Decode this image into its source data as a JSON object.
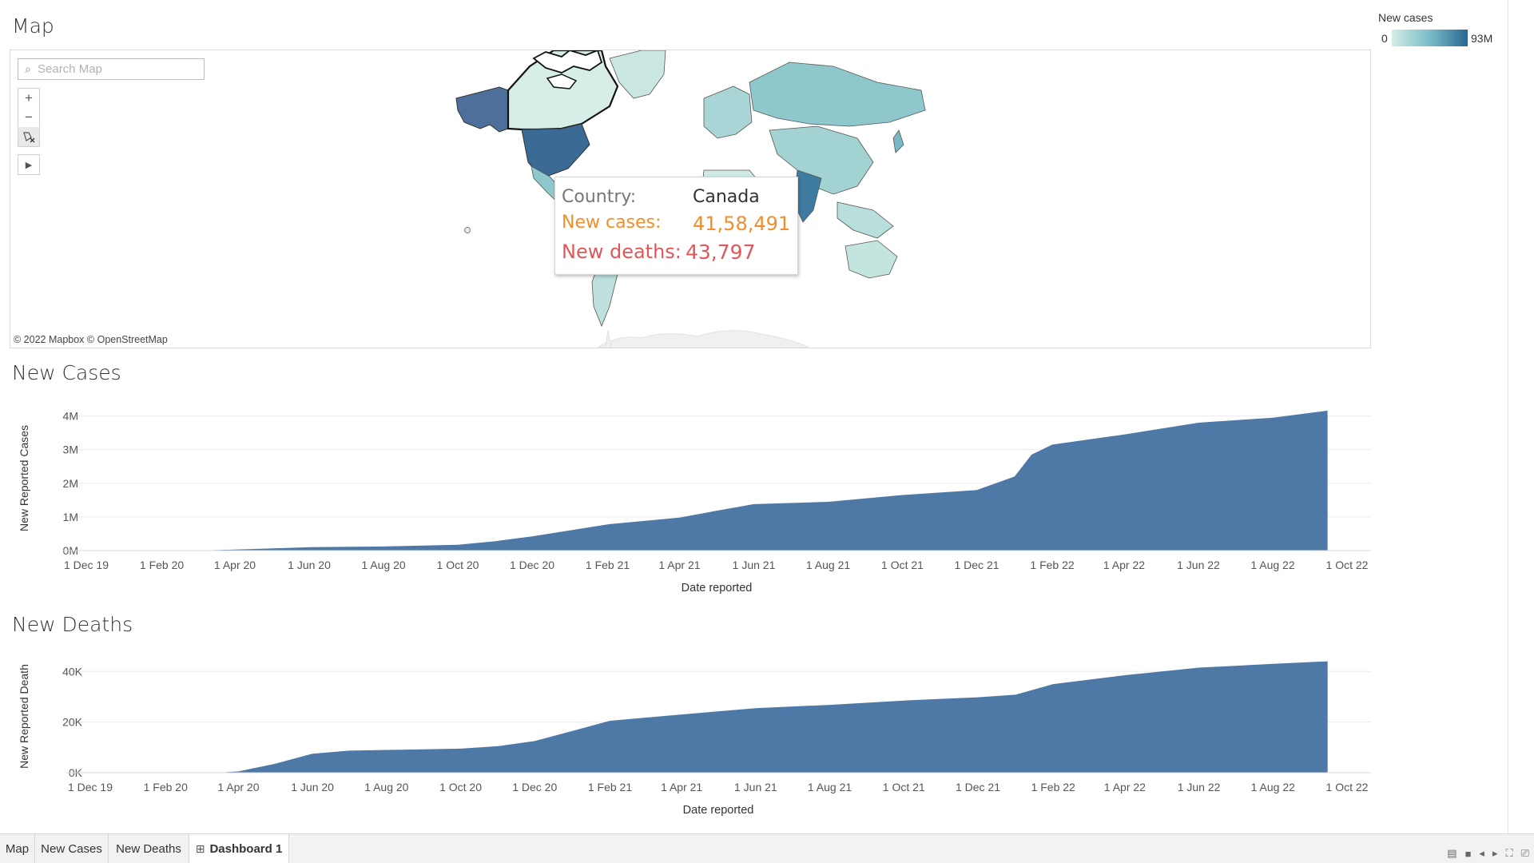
{
  "dashboard": {
    "map_title": "Map",
    "cases_title": "New Cases",
    "deaths_title": "New Deaths"
  },
  "map": {
    "search_placeholder": "Search Map",
    "attribution": "© 2022 Mapbox © OpenStreetMap",
    "tools": {
      "zoom_in": "+",
      "zoom_out": "−"
    }
  },
  "legend": {
    "title": "New cases",
    "min": "0",
    "max": "93M",
    "color_low": "#cde8e4",
    "color_high": "#2f6d91"
  },
  "tooltip": {
    "country_label": "Country:",
    "country_value": "Canada",
    "cases_label": "New cases:",
    "cases_value": "41,58,491",
    "deaths_label": "New deaths:",
    "deaths_value": "43,797",
    "cases_color": "#f28e2b",
    "deaths_color": "#e15759"
  },
  "chart_data": [
    {
      "type": "area",
      "title": "New Cases",
      "xlabel": "Date reported",
      "ylabel": "New Reported Cases",
      "x_ticks": [
        "1 Dec 19",
        "1 Feb 20",
        "1 Apr 20",
        "1 Jun 20",
        "1 Aug 20",
        "1 Oct 20",
        "1 Dec 20",
        "1 Feb 21",
        "1 Apr 21",
        "1 Jun 21",
        "1 Aug 21",
        "1 Oct 21",
        "1 Dec 21",
        "1 Feb 22",
        "1 Apr 22",
        "1 Jun 22",
        "1 Aug 22",
        "1 Oct 22"
      ],
      "y_ticks": [
        "0M",
        "1M",
        "2M",
        "3M",
        "4M"
      ],
      "ylim": [
        0,
        4.3
      ],
      "y_unit": "M",
      "color": "#4e79a7",
      "points": [
        [
          "1 Mar 20",
          0.0
        ],
        [
          "1 Apr 20",
          0.03
        ],
        [
          "1 Jun 20",
          0.1
        ],
        [
          "1 Aug 20",
          0.12
        ],
        [
          "1 Oct 20",
          0.17
        ],
        [
          "1 Nov 20",
          0.28
        ],
        [
          "1 Dec 20",
          0.42
        ],
        [
          "1 Jan 21",
          0.6
        ],
        [
          "1 Feb 21",
          0.78
        ],
        [
          "1 Apr 21",
          0.98
        ],
        [
          "1 May 21",
          1.18
        ],
        [
          "1 Jun 21",
          1.38
        ],
        [
          "1 Aug 21",
          1.45
        ],
        [
          "1 Oct 21",
          1.65
        ],
        [
          "1 Dec 21",
          1.8
        ],
        [
          "1 Jan 22",
          2.2
        ],
        [
          "15 Jan 22",
          2.85
        ],
        [
          "1 Feb 22",
          3.15
        ],
        [
          "1 Apr 22",
          3.45
        ],
        [
          "1 Jun 22",
          3.8
        ],
        [
          "1 Aug 22",
          3.95
        ],
        [
          "15 Sep 22",
          4.16
        ]
      ]
    },
    {
      "type": "area",
      "title": "New Deaths",
      "xlabel": "Date reported",
      "ylabel": "New Reported Death",
      "x_ticks": [
        "1 Dec 19",
        "1 Feb 20",
        "1 Apr 20",
        "1 Jun 20",
        "1 Aug 20",
        "1 Oct 20",
        "1 Dec 20",
        "1 Feb 21",
        "1 Apr 21",
        "1 Jun 21",
        "1 Aug 21",
        "1 Oct 21",
        "1 Dec 21",
        "1 Feb 22",
        "1 Apr 22",
        "1 Jun 22",
        "1 Aug 22",
        "1 Oct 22"
      ],
      "y_ticks": [
        "0K",
        "20K",
        "40K"
      ],
      "ylim": [
        0,
        44.5
      ],
      "y_unit": "K",
      "color": "#4e79a7",
      "points": [
        [
          "15 Mar 20",
          0.0
        ],
        [
          "1 Apr 20",
          0.5
        ],
        [
          "1 May 20",
          3.5
        ],
        [
          "1 Jun 20",
          7.5
        ],
        [
          "1 Jul 20",
          8.7
        ],
        [
          "1 Aug 20",
          9.0
        ],
        [
          "1 Oct 20",
          9.5
        ],
        [
          "1 Nov 20",
          10.5
        ],
        [
          "1 Dec 20",
          12.5
        ],
        [
          "1 Jan 21",
          16.5
        ],
        [
          "1 Feb 21",
          20.5
        ],
        [
          "1 Apr 21",
          23.0
        ],
        [
          "1 Jun 21",
          25.5
        ],
        [
          "1 Aug 21",
          26.8
        ],
        [
          "1 Oct 21",
          28.5
        ],
        [
          "1 Dec 21",
          29.8
        ],
        [
          "1 Jan 22",
          30.8
        ],
        [
          "1 Feb 22",
          35.0
        ],
        [
          "1 Apr 22",
          38.5
        ],
        [
          "1 Jun 22",
          41.5
        ],
        [
          "1 Aug 22",
          43.0
        ],
        [
          "15 Sep 22",
          44.0
        ]
      ]
    }
  ],
  "tabs": [
    {
      "label": "Map",
      "active": false
    },
    {
      "label": "New Cases",
      "active": false
    },
    {
      "label": "New Deaths",
      "active": false
    },
    {
      "label": "Dashboard 1",
      "active": true
    }
  ]
}
